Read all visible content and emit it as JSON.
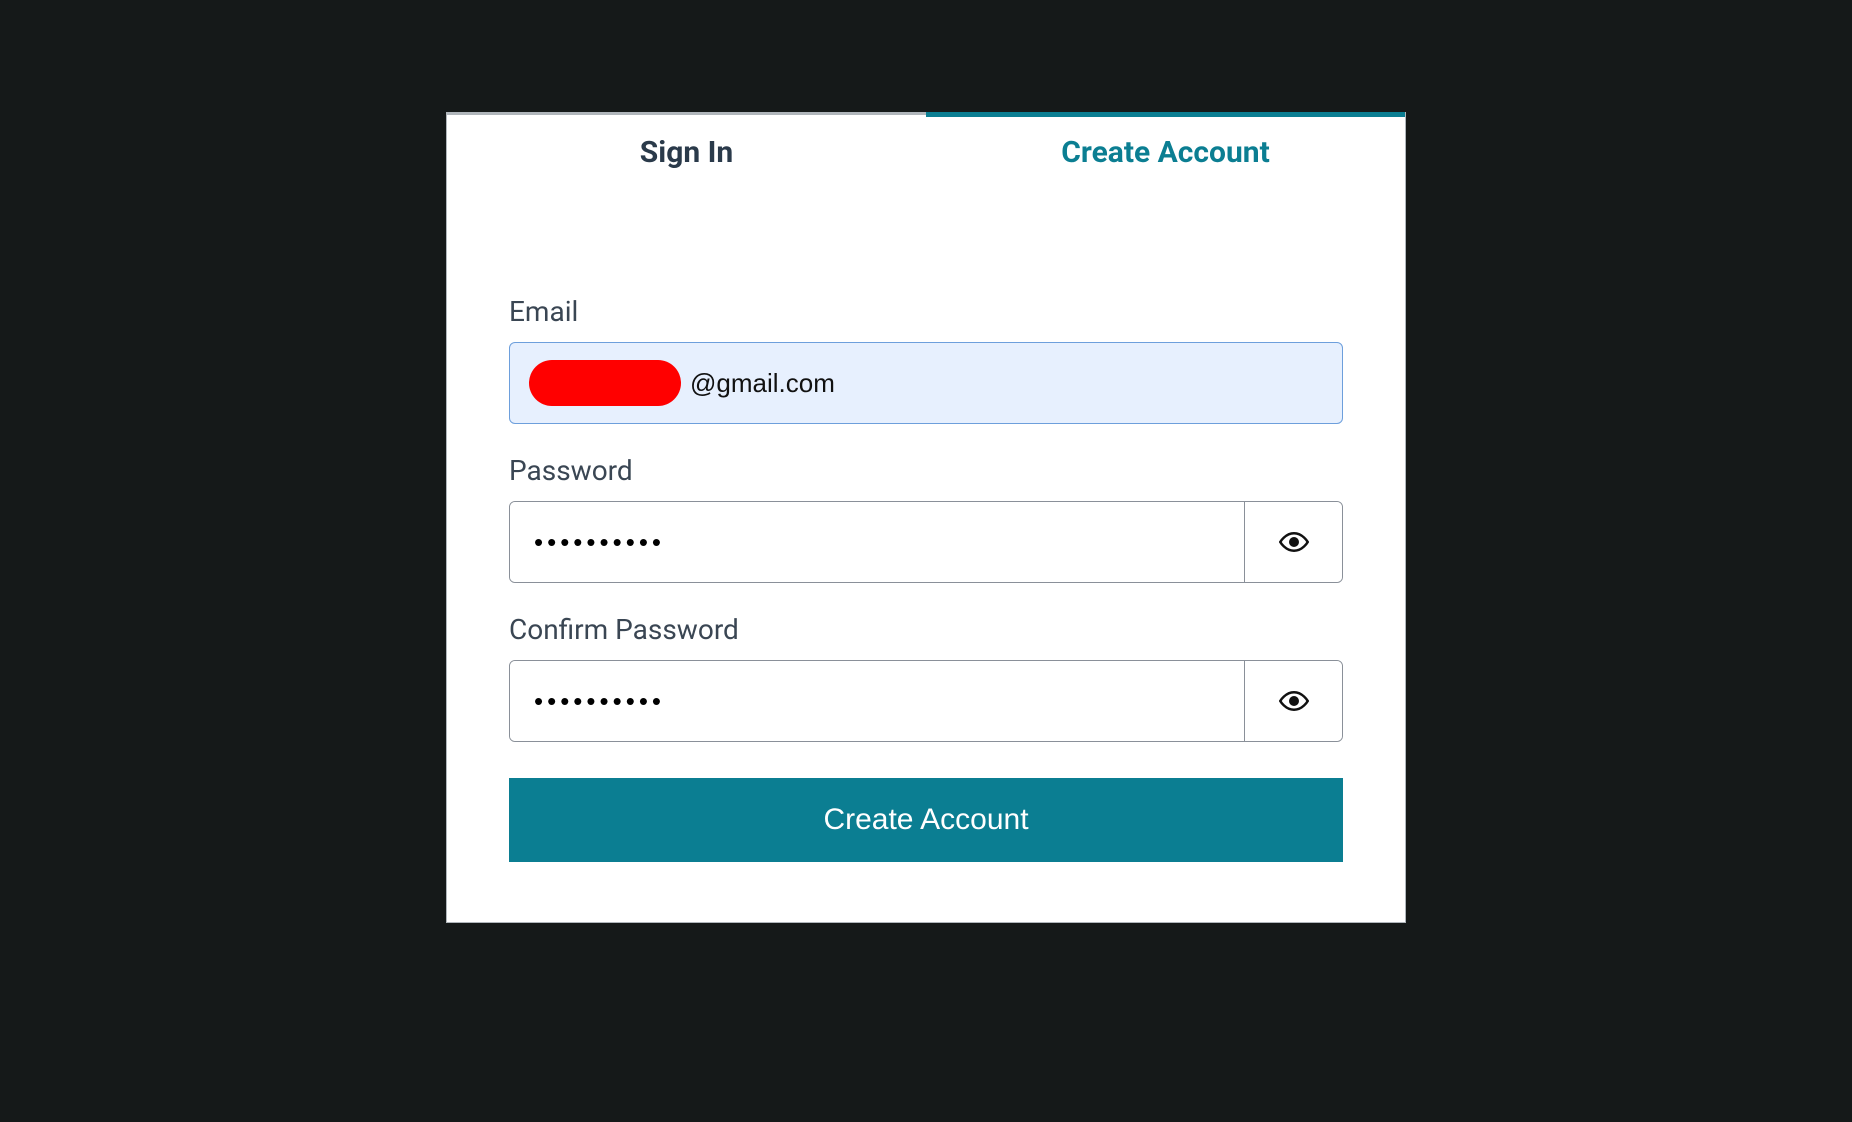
{
  "tabs": {
    "signin": "Sign In",
    "create": "Create Account"
  },
  "form": {
    "email_label": "Email",
    "email_value": "@gmail.com",
    "password_label": "Password",
    "password_value": "••••••••••",
    "confirm_label": "Confirm Password",
    "confirm_value": "••••••••••",
    "submit_label": "Create Account"
  },
  "colors": {
    "accent": "#0b7e92",
    "background": "#151919",
    "autofill": "#e7f0fe",
    "redaction": "#ff0000"
  }
}
